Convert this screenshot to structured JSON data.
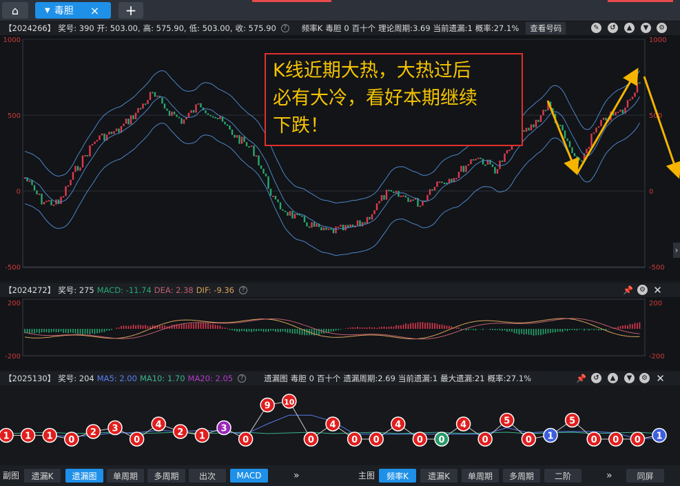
{
  "tabs": {
    "home": "⌂",
    "active_tab": "毒胆",
    "close": "×",
    "add": "+"
  },
  "top_info": {
    "period": "【2024266】",
    "award": "奖号: 390",
    "open": "开: 503.00,",
    "high": "高: 575.90,",
    "low": "低: 503.00,",
    "close": "收: 575.90",
    "freq": "频率K",
    "du": "毒胆",
    "du_val": "0",
    "pos": "百十个",
    "cycle": "理论周期:3.69",
    "miss": "当前遗漏:1",
    "prob": "概率:27.1%",
    "view_btn": "查看号码"
  },
  "main_chart": {
    "y_left": [
      "1000",
      "500",
      "0",
      "-500"
    ],
    "y_right": [
      "1000",
      "500",
      "0",
      "-500"
    ]
  },
  "annotation": {
    "lines": [
      "K线近期大热，大热过后",
      "必有大冷，看好本期继续",
      "下跌！"
    ]
  },
  "macd_info": {
    "period": "【2024272】",
    "award": "奖号: 275",
    "macd": "MACD: -11.74",
    "dea": "DEA: 2.38",
    "dif": "DIF: -9.36"
  },
  "macd_chart": {
    "y_left": [
      "200",
      "-200"
    ],
    "y_right": [
      "200",
      "-200"
    ]
  },
  "miss_info": {
    "period": "【2025130】",
    "award": "奖号: 204",
    "ma5": "MA5: 2.00",
    "ma10": "MA10: 1.70",
    "ma20": "MA20: 2.05",
    "chart": "遗漏图",
    "du": "毒胆",
    "du_val": "0",
    "pos": "百十个",
    "cycle": "遗漏周期:2.69",
    "miss": "当前遗漏:1",
    "max_miss": "最大遗漏:21",
    "prob": "概率:27.1%"
  },
  "miss_balls": [
    {
      "v": "1",
      "c": "red"
    },
    {
      "v": "1",
      "c": "red"
    },
    {
      "v": "1",
      "c": "red"
    },
    {
      "v": "0",
      "c": "red"
    },
    {
      "v": "2",
      "c": "red"
    },
    {
      "v": "3",
      "c": "red"
    },
    {
      "v": "0",
      "c": "red"
    },
    {
      "v": "4",
      "c": "red"
    },
    {
      "v": "2",
      "c": "red"
    },
    {
      "v": "1",
      "c": "red"
    },
    {
      "v": "3",
      "c": "purple"
    },
    {
      "v": "0",
      "c": "red"
    },
    {
      "v": "9",
      "c": "red"
    },
    {
      "v": "10",
      "c": "red"
    },
    {
      "v": "0",
      "c": "red"
    },
    {
      "v": "4",
      "c": "red"
    },
    {
      "v": "0",
      "c": "red"
    },
    {
      "v": "0",
      "c": "red"
    },
    {
      "v": "4",
      "c": "red"
    },
    {
      "v": "0",
      "c": "red"
    },
    {
      "v": "0",
      "c": "green"
    },
    {
      "v": "4",
      "c": "red"
    },
    {
      "v": "0",
      "c": "red"
    },
    {
      "v": "5",
      "c": "red"
    },
    {
      "v": "0",
      "c": "red"
    },
    {
      "v": "1",
      "c": "blue"
    },
    {
      "v": "5",
      "c": "red"
    },
    {
      "v": "0",
      "c": "red"
    },
    {
      "v": "0",
      "c": "red"
    },
    {
      "v": "0",
      "c": "red"
    },
    {
      "v": "1",
      "c": "blue"
    }
  ],
  "bottom_left": {
    "label": "副图",
    "btns": [
      "遗漏K",
      "遗漏图",
      "单周期",
      "多周期",
      "出次",
      "MACD"
    ],
    "more": "»"
  },
  "bottom_right": {
    "label": "主图",
    "btns": [
      "频率K",
      "遗漏K",
      "单周期",
      "多周期",
      "二阶"
    ],
    "more": "»",
    "full": "同屏"
  },
  "colors": {
    "up": "#e03a50",
    "down": "#27a870",
    "band": "#4f86c6",
    "accent": "#1e90e8",
    "arrow": "#f5b400"
  }
}
